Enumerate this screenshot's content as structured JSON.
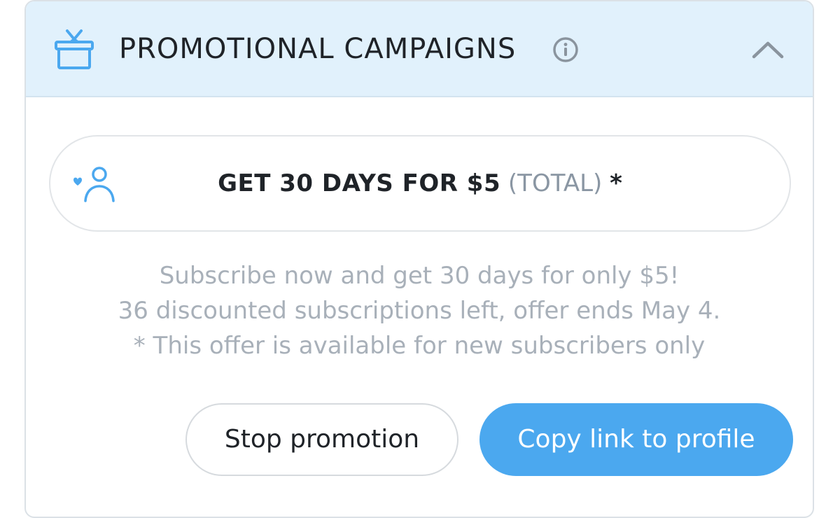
{
  "header": {
    "title": "PROMOTIONAL CAMPAIGNS",
    "icons": {
      "left": "gift-icon",
      "info": "info-icon",
      "collapse": "chevron-up-icon"
    }
  },
  "offer": {
    "icon": "heart-user-icon",
    "main": "GET 30 DAYS FOR $5",
    "total": "(TOTAL)",
    "star": "*"
  },
  "description": {
    "line1": "Subscribe now and get 30 days for only $5!",
    "line2": "36 discounted subscriptions left, offer ends May 4.",
    "line3": "* This offer is available for new subscribers only"
  },
  "buttons": {
    "stop": "Stop promotion",
    "copy": "Copy link to profile"
  },
  "colors": {
    "accent": "#4ba8ef",
    "header_bg": "#e1f1fc",
    "muted_text": "#a8b0b9"
  }
}
